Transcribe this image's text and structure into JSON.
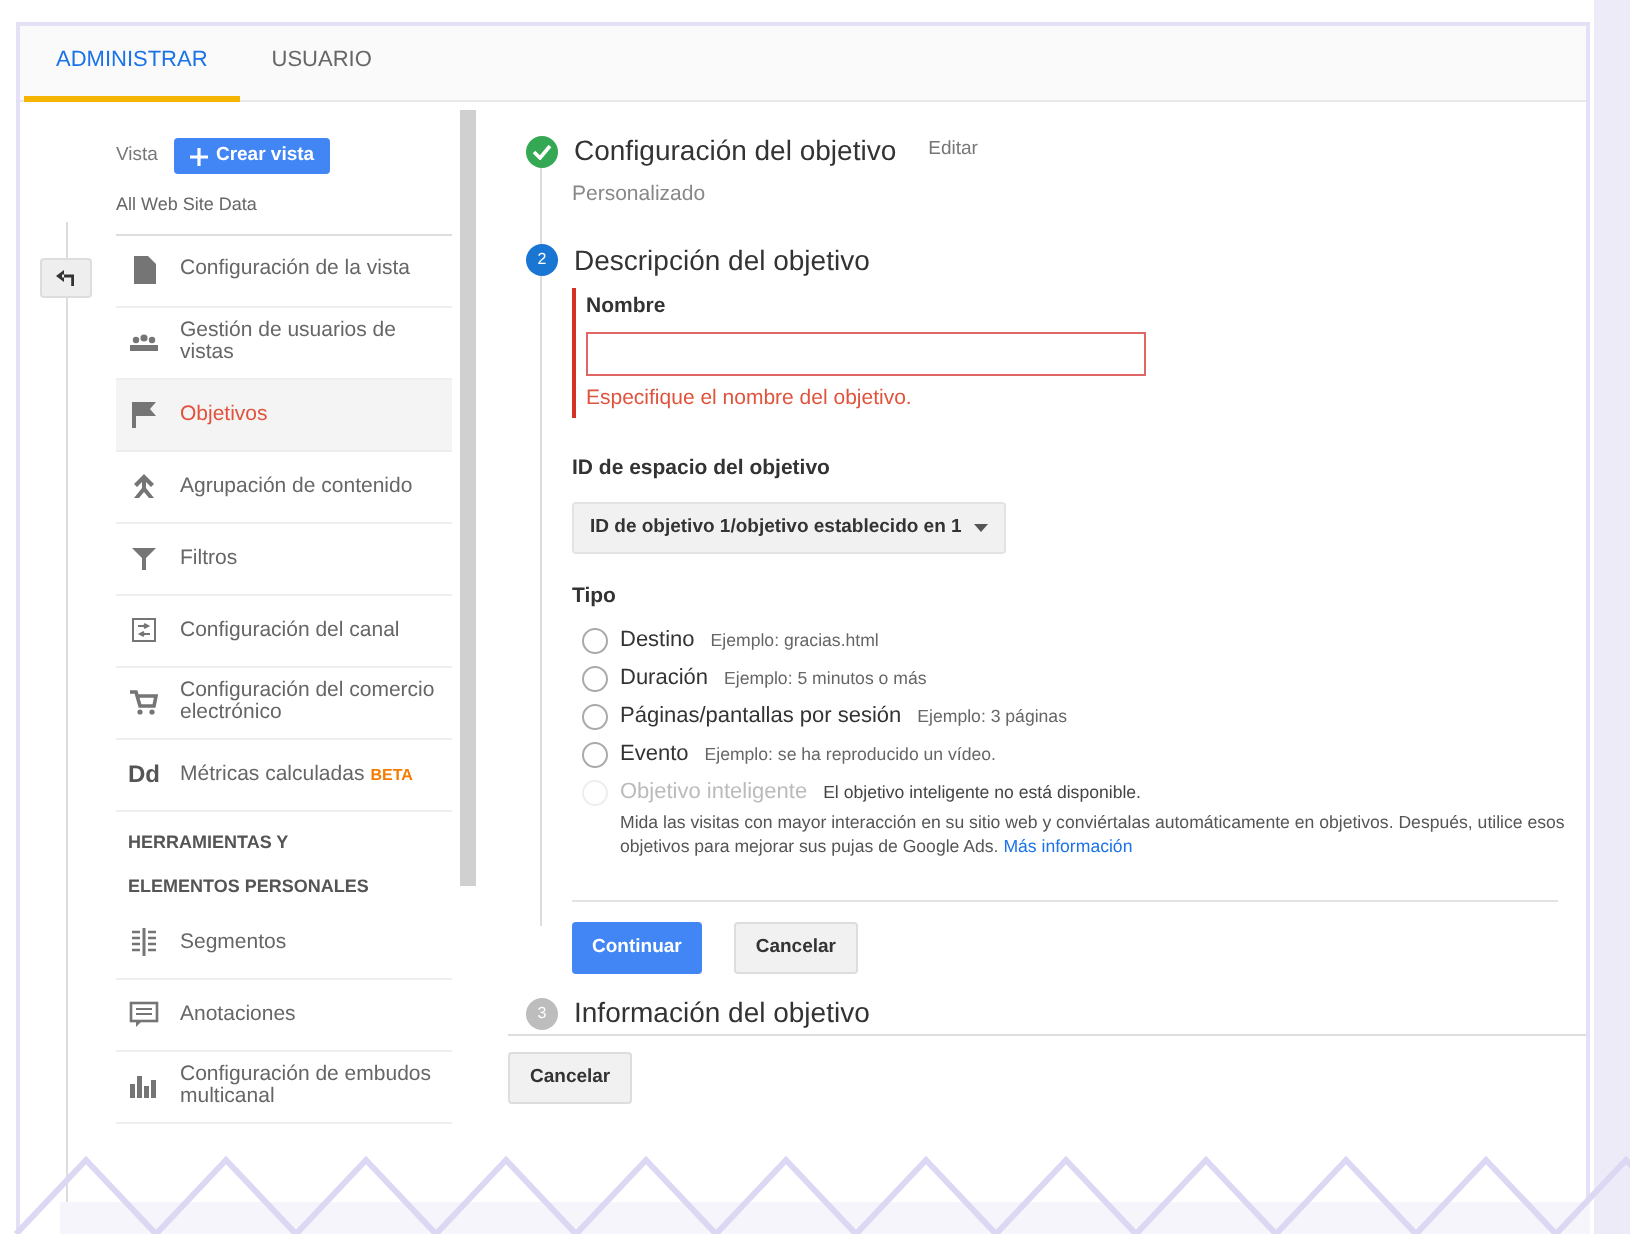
{
  "tabs": [
    {
      "label": "ADMINISTRAR",
      "selected": true
    },
    {
      "label": "USUARIO",
      "selected": false
    }
  ],
  "sidebar": {
    "view_label": "Vista",
    "create_button": "Crear vista",
    "view_name": "All Web Site Data",
    "items": [
      {
        "label": "Configuración de la vista",
        "selected": false
      },
      {
        "label": "Gestión de usuarios de vistas",
        "selected": false
      },
      {
        "label": "Objetivos",
        "selected": true
      },
      {
        "label": "Agrupación de contenido",
        "selected": false
      },
      {
        "label": "Filtros",
        "selected": false
      },
      {
        "label": "Configuración del canal",
        "selected": false
      },
      {
        "label": "Configuración del comercio electrónico",
        "selected": false
      },
      {
        "label": "Métricas calculadas",
        "badge": "BETA",
        "icon_text": "Dd",
        "selected": false
      }
    ],
    "section_heading": "HERRAMIENTAS Y ELEMENTOS PERSONALES",
    "tool_items": [
      {
        "label": "Segmentos",
        "selected": false
      },
      {
        "label": "Anotaciones",
        "selected": false
      },
      {
        "label": "Configuración de embudos multicanal",
        "selected": false
      }
    ]
  },
  "steps": [
    {
      "kind": "done",
      "title": "Configuración del objetivo",
      "action": "Editar",
      "subtitle": "Personalizado"
    },
    {
      "kind": "current",
      "number": "2",
      "title": "Descripción del objetivo"
    },
    {
      "kind": "pending",
      "number": "3",
      "title": "Información del objetivo"
    }
  ],
  "form": {
    "name_label": "Nombre",
    "name_error": "Especifique el nombre del objetivo.",
    "slot_label": "ID de espacio del objetivo",
    "slot_value": "ID de objetivo 1/objetivo establecido en 1",
    "type_label": "Tipo",
    "options": [
      {
        "label": "Destino",
        "example": "Ejemplo: gracias.html",
        "selected": false,
        "disabled": false
      },
      {
        "label": "Duración",
        "example": "Ejemplo: 5 minutos o más",
        "selected": false,
        "disabled": false
      },
      {
        "label": "Páginas/pantallas por sesión",
        "example": "Ejemplo: 3 páginas",
        "selected": false,
        "disabled": false
      },
      {
        "label": "Evento",
        "example": "Ejemplo: se ha reproducido un vídeo.",
        "selected": false,
        "disabled": false
      },
      {
        "label": "Objetivo inteligente",
        "example": "El objetivo inteligente no está disponible.",
        "selected": false,
        "disabled": true
      }
    ],
    "smart_description": "Mida las visitas con mayor interacción en su sitio web y conviértalas automáticamente en objetivos. Después, utilice esos objetivos para mejorar sus pujas de Google Ads.",
    "smart_link": "Más información",
    "continue_button": "Continuar",
    "cancel_button": "Cancelar"
  },
  "footer_cancel_button": "Cancelar"
}
